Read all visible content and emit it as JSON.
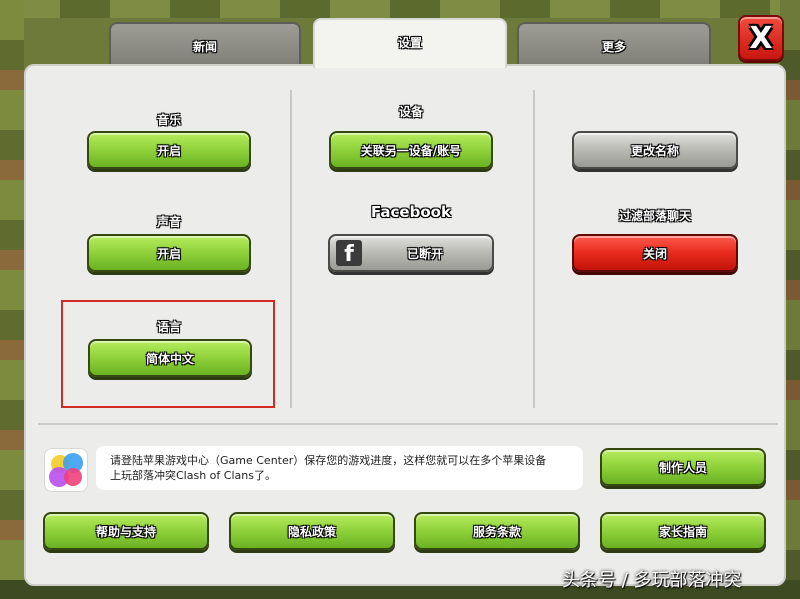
{
  "tabs": [
    {
      "label": "新闻",
      "active": false
    },
    {
      "label": "设置",
      "active": true
    },
    {
      "label": "更多",
      "active": false
    }
  ],
  "close_label": "X",
  "settings": {
    "music": {
      "label": "音乐",
      "button": "开启"
    },
    "sound": {
      "label": "声音",
      "button": "开启"
    },
    "language": {
      "label": "语言",
      "button": "简体中文"
    },
    "device": {
      "label": "设备",
      "button": "关联另一设备/账号"
    },
    "facebook": {
      "label": "Facebook",
      "button": "已断开",
      "icon": "facebook-f-icon"
    },
    "rename": {
      "button": "更改名称"
    },
    "chat_filter": {
      "label": "过滤部落聊天",
      "button": "关闭"
    }
  },
  "game_center": {
    "icon": "game-center-icon",
    "line1": "请登陆苹果游戏中心（Game Center）保存您的游戏进度，这样您就可以在多个苹果设备",
    "line2": "上玩部落冲突Clash of Clans了。"
  },
  "bottom_buttons": {
    "credits": "制作人员",
    "help": "帮助与支持",
    "privacy": "隐私政策",
    "terms": "服务条款",
    "parents": "家长指南"
  },
  "watermark": "头条号 / 多玩部落冲突",
  "colors": {
    "green_button": "#8fd13a",
    "gray_button": "#b9b9b4",
    "red_button": "#e72a1d",
    "highlight_box": "#d22a25",
    "panel_bg": "#ececea"
  }
}
